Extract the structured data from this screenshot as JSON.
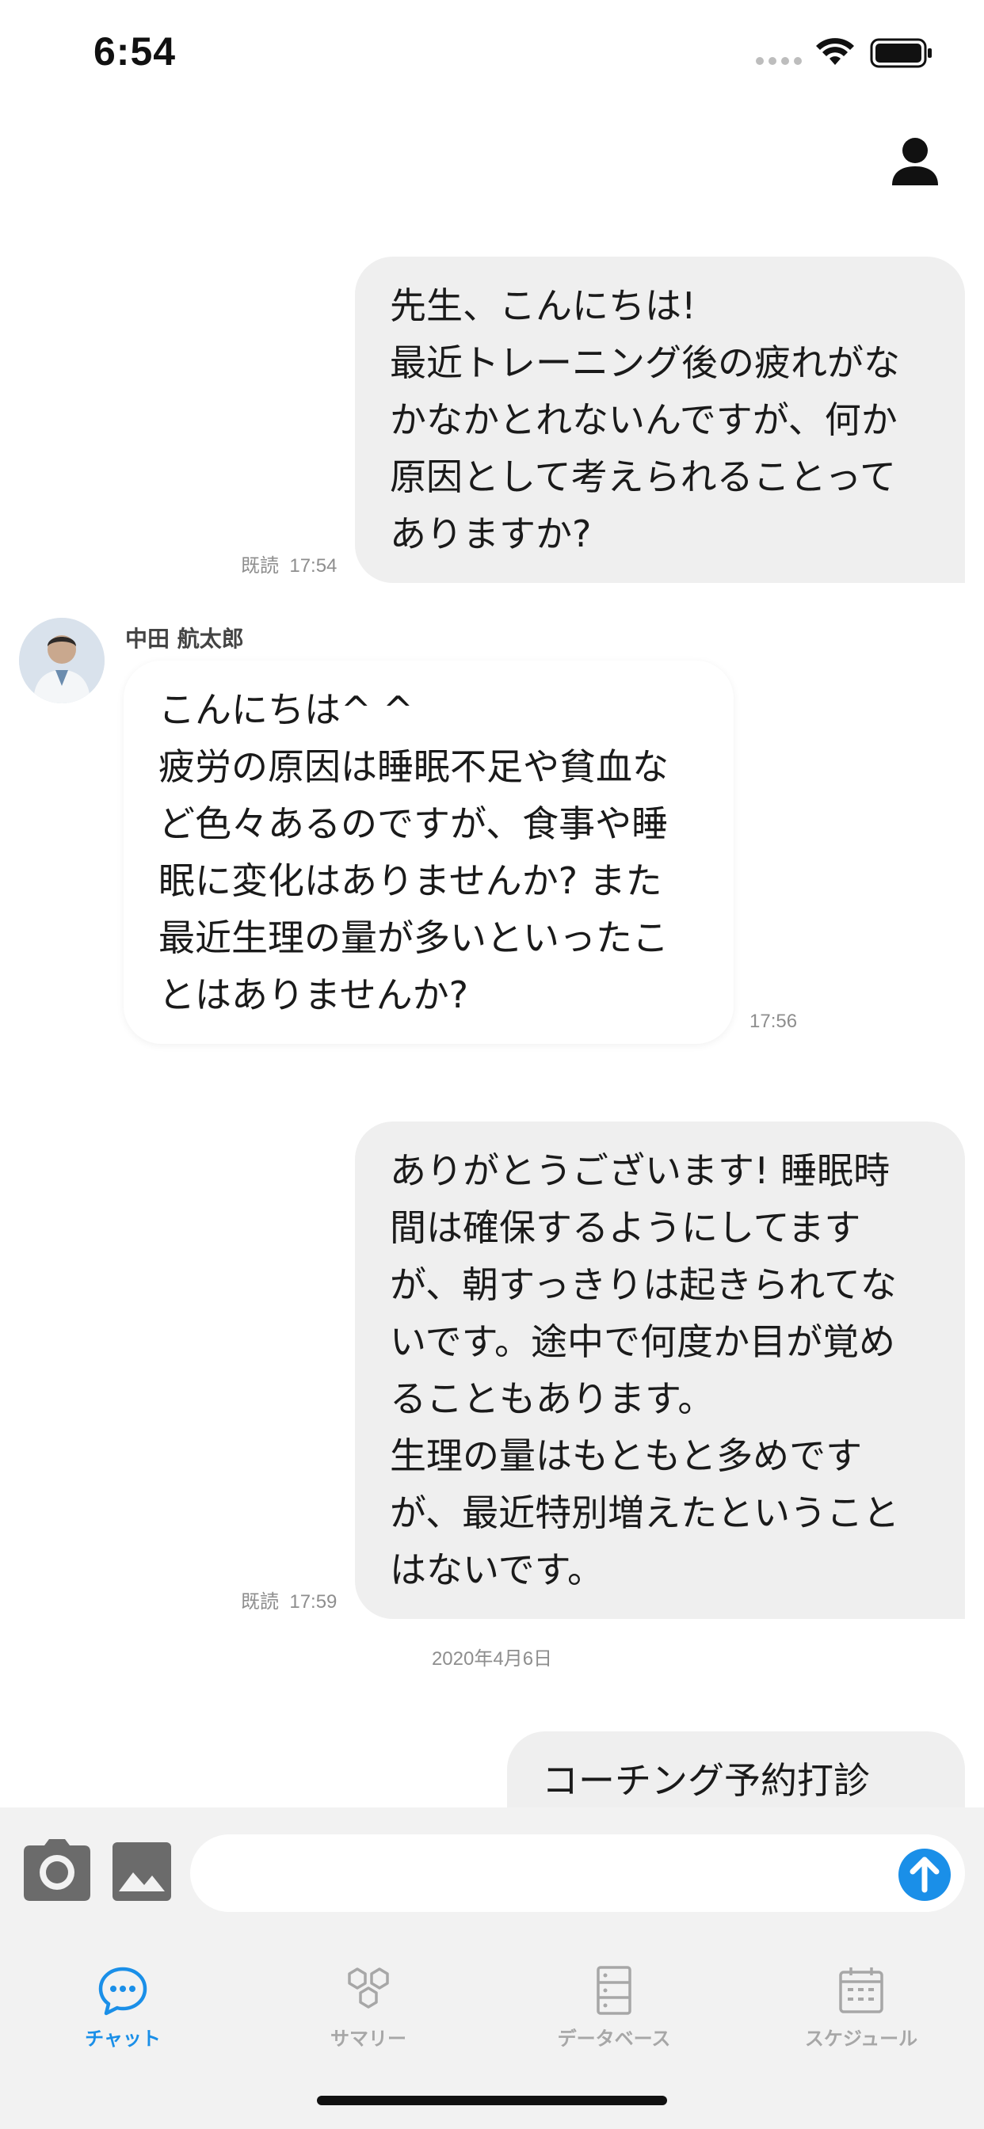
{
  "status_bar": {
    "time": "6:54"
  },
  "header": {
    "profile_icon": "person-icon"
  },
  "messages": [
    {
      "direction": "sent",
      "text": "先生、こんにちは!\n最近トレーニング後の疲れがな\nかなかとれないんですが、何か\n原因として考えられることって\nありますか?",
      "read_label": "既読",
      "time": "17:54"
    },
    {
      "direction": "received",
      "sender": "中田 航太郎",
      "text": "こんにちは^ ^\n疲労の原因は睡眠不足や貧血な\nど色々あるのですが、食事や睡\n眠に変化はありませんか? また\n最近生理の量が多いといったこ\nとはありませんか?",
      "time": "17:56"
    },
    {
      "direction": "sent",
      "text": "ありがとうございます! 睡眠時\n間は確保するようにしてます\nが、朝すっきりは起きられてな\nいです。途中で何度か目が覚め\nることもあります。\n生理の量はもともと多めです\nが、最近特別増えたということ\nはないです。",
      "read_label": "既読",
      "time": "17:59"
    },
    {
      "direction": "sent",
      "text": "コーチング予約打診"
    }
  ],
  "date_divider": "2020年4月6日",
  "composer": {
    "camera_icon": "camera-icon",
    "image_icon": "image-icon",
    "send_icon": "arrow-up-icon",
    "input_value": "",
    "placeholder": ""
  },
  "tab_bar": {
    "tabs": [
      {
        "label": "チャット",
        "icon": "chat-bubble-icon",
        "active": true
      },
      {
        "label": "サマリー",
        "icon": "hexagons-icon",
        "active": false
      },
      {
        "label": "データベース",
        "icon": "database-icon",
        "active": false
      },
      {
        "label": "スケジュール",
        "icon": "calendar-icon",
        "active": false
      }
    ]
  },
  "colors": {
    "accent": "#1a8fe8",
    "sent_bubble": "#efefef",
    "received_bubble": "#ffffff",
    "inactive_tab": "#a7a7a7"
  }
}
